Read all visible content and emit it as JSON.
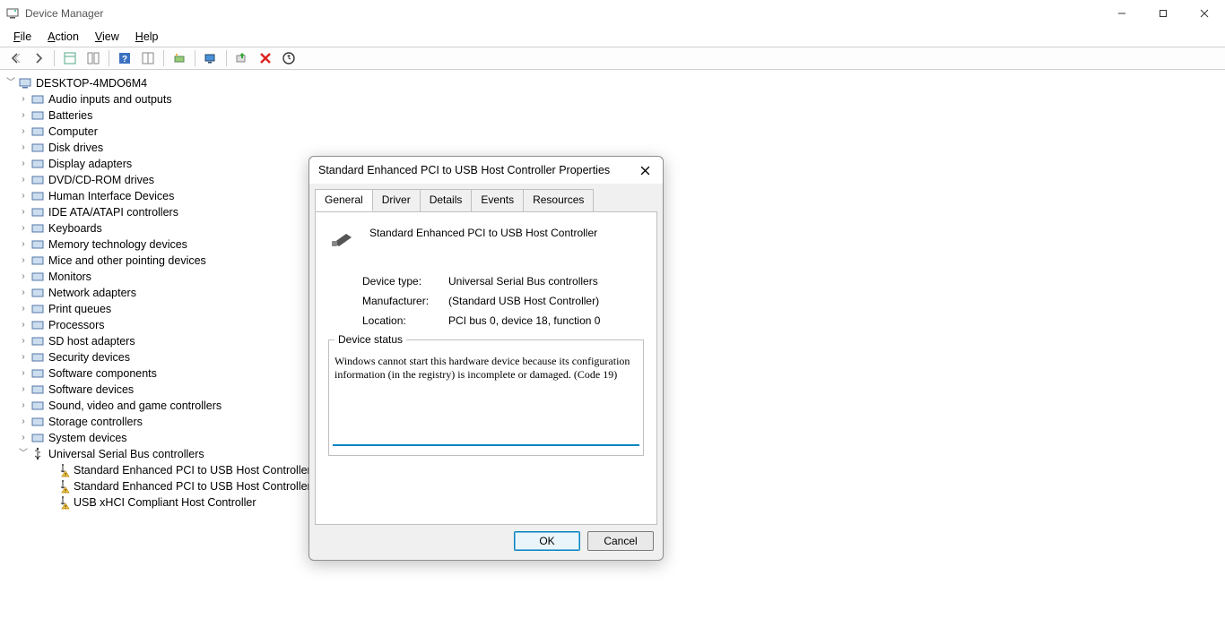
{
  "window": {
    "title": "Device Manager"
  },
  "menus": {
    "file": "File",
    "action": "Action",
    "view": "View",
    "help": "Help"
  },
  "tree": {
    "root": "DESKTOP-4MDO6M4",
    "cats": [
      "Audio inputs and outputs",
      "Batteries",
      "Computer",
      "Disk drives",
      "Display adapters",
      "DVD/CD-ROM drives",
      "Human Interface Devices",
      "IDE ATA/ATAPI controllers",
      "Keyboards",
      "Memory technology devices",
      "Mice and other pointing devices",
      "Monitors",
      "Network adapters",
      "Print queues",
      "Processors",
      "SD host adapters",
      "Security devices",
      "Software components",
      "Software devices",
      "Sound, video and game controllers",
      "Storage controllers",
      "System devices"
    ],
    "usb_cat": "Universal Serial Bus controllers",
    "usb_children": [
      "Standard Enhanced PCI to USB Host Controller",
      "Standard Enhanced PCI to USB Host Controller",
      "USB xHCI Compliant Host Controller"
    ]
  },
  "dialog": {
    "title": "Standard Enhanced PCI to USB Host Controller Properties",
    "tabs": {
      "general": "General",
      "driver": "Driver",
      "details": "Details",
      "events": "Events",
      "resources": "Resources"
    },
    "device_name": "Standard Enhanced PCI to USB Host Controller",
    "labels": {
      "type": "Device type:",
      "mfr": "Manufacturer:",
      "loc": "Location:",
      "status": "Device status"
    },
    "values": {
      "type": "Universal Serial Bus controllers",
      "mfr": "(Standard USB Host Controller)",
      "loc": "PCI bus 0, device 18, function 0"
    },
    "status_text": "Windows cannot start this hardware device because its configuration information (in the registry) is incomplete or damaged. (Code 19)",
    "ok": "OK",
    "cancel": "Cancel"
  }
}
